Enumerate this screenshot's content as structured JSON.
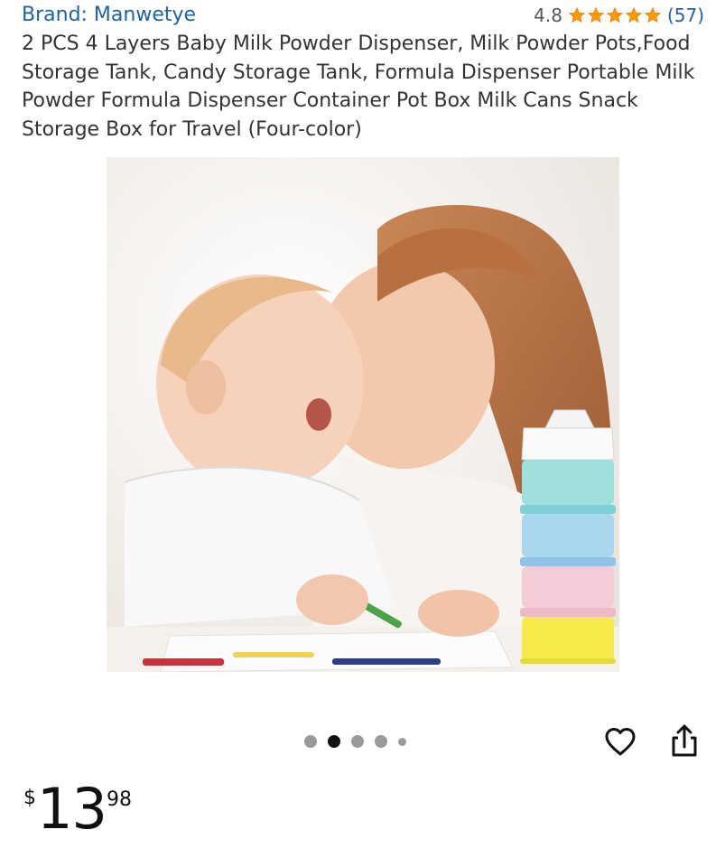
{
  "header": {
    "brand_link": "Brand: Manwetye",
    "rating_value": "4.8",
    "rating_stars": 4.8,
    "rating_count": "(57)",
    "star_color": "#ff9900"
  },
  "product": {
    "title": "2 PCS 4 Layers Baby Milk Powder Dispenser, Milk Powder Pots,Food Storage Tank, Candy Storage Tank, Formula Dispenser Portable Milk Powder Formula Dispenser Container Pot Box Milk Cans Snack Storage Box for Travel (Four-color)"
  },
  "carousel": {
    "image_count": 5,
    "active_index": 1
  },
  "actions": {
    "favorite_icon": "heart-icon",
    "share_icon": "share-icon"
  },
  "price": {
    "symbol": "$",
    "whole": "13",
    "fraction": "98"
  },
  "colors": {
    "link": "#2162a1",
    "star": "#ff9900",
    "text": "#0f1111"
  }
}
